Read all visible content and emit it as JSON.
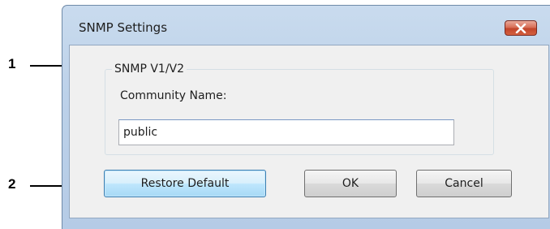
{
  "callouts": [
    {
      "number": "1"
    },
    {
      "number": "2"
    }
  ],
  "window": {
    "title": "SNMP Settings",
    "close_icon": "close-icon"
  },
  "group": {
    "label": "SNMP V1/V2",
    "field_label": "Community Name:",
    "community_name_value": "public"
  },
  "buttons": {
    "restore_default": "Restore Default",
    "ok": "OK",
    "cancel": "Cancel"
  },
  "colors": {
    "title_bar": "#bcd1e9",
    "close_button": "#c2452b",
    "focused_button_border": "#3c7fb1"
  }
}
